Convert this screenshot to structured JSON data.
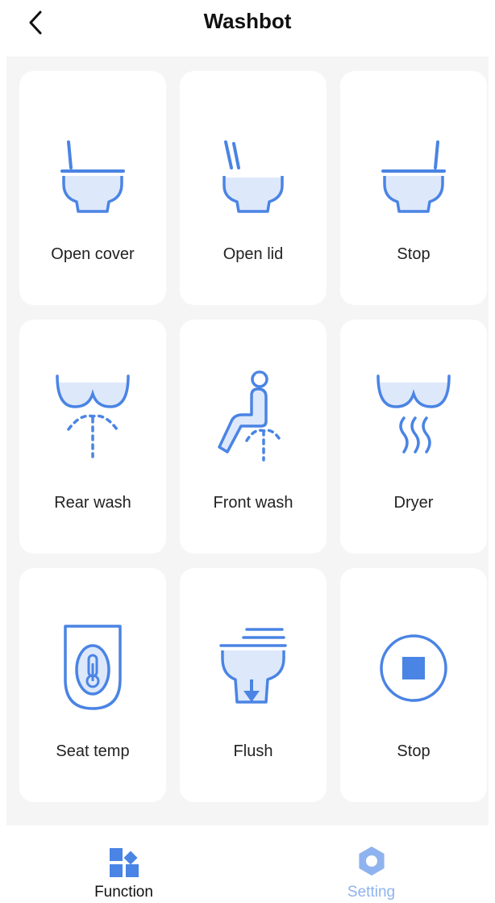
{
  "header": {
    "title": "Washbot"
  },
  "colors": {
    "accent": "#4a84e4",
    "icon_fill": "#dde8fb",
    "inactive": "#8fb3ee"
  },
  "cards": [
    {
      "label": "Open cover",
      "icon": "toilet-open-cover-icon"
    },
    {
      "label": "Open lid",
      "icon": "toilet-open-lid-icon"
    },
    {
      "label": "Stop",
      "icon": "toilet-stop-icon"
    },
    {
      "label": "Rear wash",
      "icon": "rear-wash-icon"
    },
    {
      "label": "Front wash",
      "icon": "front-wash-icon"
    },
    {
      "label": "Dryer",
      "icon": "dryer-icon"
    },
    {
      "label": "Seat temp",
      "icon": "seat-temp-icon"
    },
    {
      "label": "Flush",
      "icon": "flush-icon"
    },
    {
      "label": "Stop",
      "icon": "stop-icon"
    }
  ],
  "tabbar": {
    "items": [
      {
        "label": "Function",
        "icon": "function-grid-icon",
        "active": true
      },
      {
        "label": "Setting",
        "icon": "gear-icon",
        "active": false
      }
    ]
  }
}
